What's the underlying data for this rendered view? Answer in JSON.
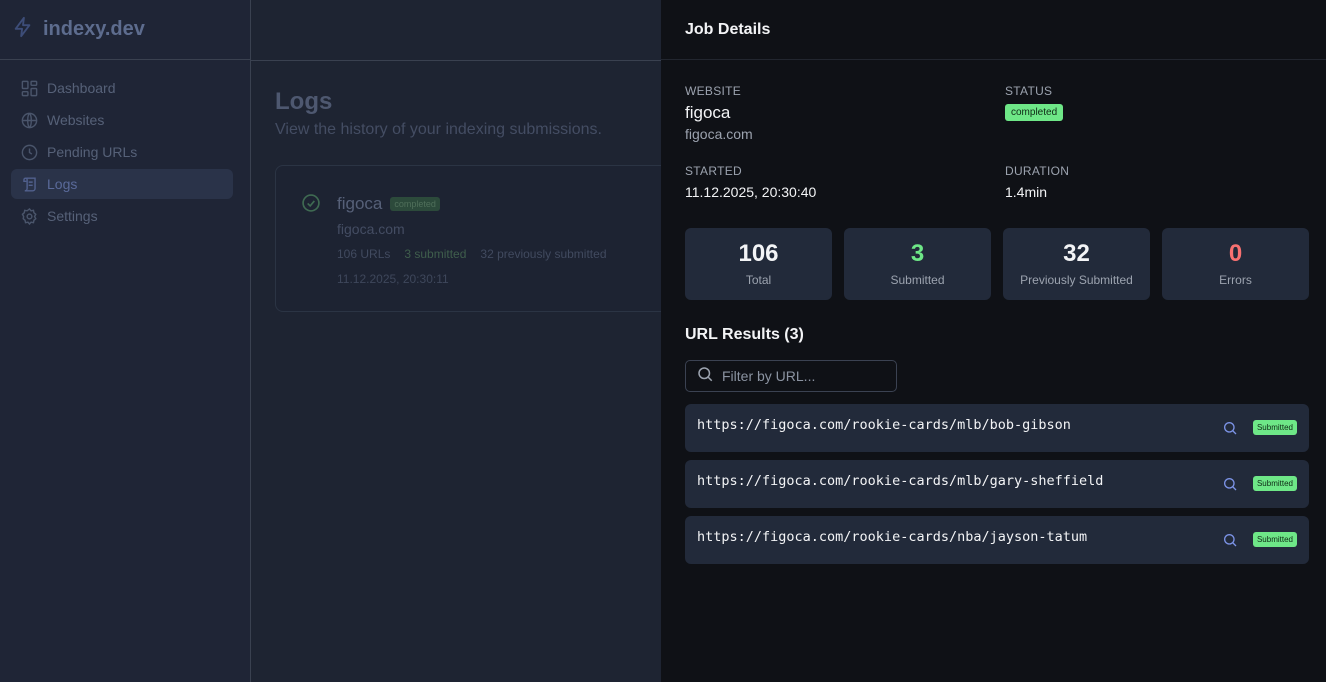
{
  "brand": {
    "name": "indexy.dev"
  },
  "sidebar": {
    "items": [
      {
        "label": "Dashboard",
        "icon": "dashboard-icon"
      },
      {
        "label": "Websites",
        "icon": "globe-icon"
      },
      {
        "label": "Pending URLs",
        "icon": "clock-icon"
      },
      {
        "label": "Logs",
        "icon": "scroll-icon",
        "active": true
      },
      {
        "label": "Settings",
        "icon": "gear-icon"
      }
    ]
  },
  "page": {
    "title": "Logs",
    "subtitle": "View the history of your indexing submissions."
  },
  "log_card": {
    "name": "figoca",
    "badge": "completed",
    "domain": "figoca.com",
    "urls": "106 URLs",
    "submitted": "3 submitted",
    "previously": "32 previously submitted",
    "date": "11.12.2025, 20:30:11"
  },
  "drawer": {
    "title": "Job Details",
    "website_label": "WEBSITE",
    "website_name": "figoca",
    "website_domain": "figoca.com",
    "status_label": "STATUS",
    "status_value": "completed",
    "started_label": "STARTED",
    "started_value": "11.12.2025, 20:30:40",
    "duration_label": "DURATION",
    "duration_value": "1.4min",
    "stats": [
      {
        "value": "106",
        "label": "Total"
      },
      {
        "value": "3",
        "label": "Submitted"
      },
      {
        "value": "32",
        "label": "Previously Submitted"
      },
      {
        "value": "0",
        "label": "Errors"
      }
    ],
    "results_title": "URL Results (3)",
    "filter_placeholder": "Filter by URL...",
    "urls": [
      {
        "url": "https://figoca.com/rookie-cards/mlb/bob-gibson",
        "status": "Submitted"
      },
      {
        "url": "https://figoca.com/rookie-cards/mlb/gary-sheffield",
        "status": "Submitted"
      },
      {
        "url": "https://figoca.com/rookie-cards/nba/jayson-tatum",
        "status": "Submitted"
      }
    ]
  },
  "colors": {
    "accent_green": "#6ee787",
    "error_red": "#f87171",
    "drawer_bg": "#0f1116",
    "card_bg": "#222a3a"
  }
}
